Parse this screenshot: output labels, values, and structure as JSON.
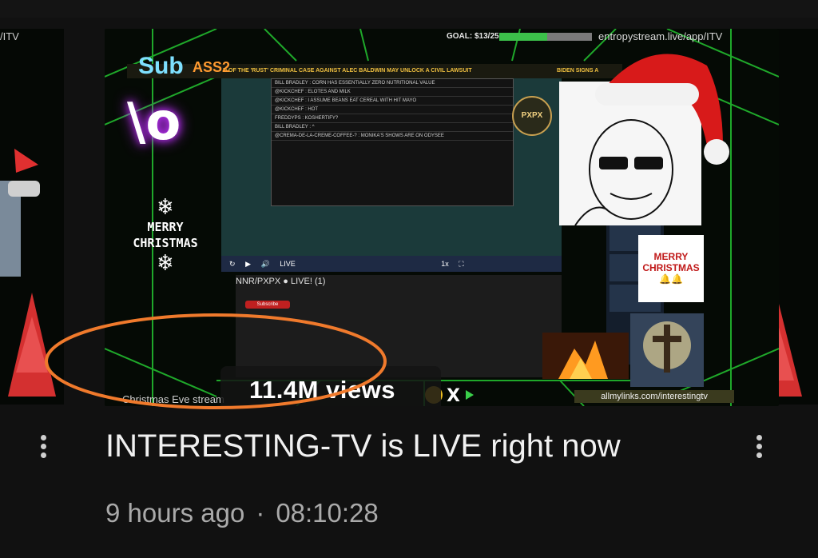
{
  "left_thumb": {
    "url_fragment": "/ITV"
  },
  "video": {
    "overlay": {
      "goal_label": "GOAL: $13/25",
      "goal_progress": 0.52,
      "stream_url": "entropystream.live/app/ITV",
      "ticker_text": "D OF THE 'RUST' CRIMINAL CASE AGAINST ALEC BALDWIN MAY UNLOCK A CIVIL LAWSUIT",
      "ticker_text2": "BIDEN SIGNS A",
      "sub_text": "Sub",
      "class_text": "ASS2",
      "neon_text": "\\o",
      "merry_christmas_top": "MERRY",
      "merry_christmas_bottom": "CHRISTMAS",
      "pxpx_badge": "PXPX",
      "stream_title": "NNR/PXPX ● LIVE! (1)",
      "subscribe_label": "Subscribe",
      "chat_lines": [
        "BILL BRADLEY : CORN HAS ESSENTIALLY ZERO NUTRITIONAL VALUE",
        "@KICKCHEF : ELOTES AND MILK",
        "@KICKCHEF : I ASSUME BEANS EAT CEREAL WITH HIT MAYO",
        "@KICKCHEF : HOT",
        "FREDDYPS : KOSHERTIFY?",
        "BILL BRADLEY : ^",
        "@CREMA-DE-LA-CREME-COFFEE-? : MONIKA'S SHOWS ARE ON ODYSEE"
      ],
      "player_live": "LIVE",
      "player_speed": "1x",
      "card_text": "MERRY CHRISTMAS",
      "footer_link": "allmylinks.com/interestingtv",
      "caption_under": "Christmas Eve stream"
    },
    "views_badge": "11.4M views",
    "title": "INTERESTING-TV is LIVE right now",
    "time_ago": "9 hours ago",
    "separator": "·",
    "duration": "08:10:28",
    "highlight_color": "#f07a2c"
  }
}
